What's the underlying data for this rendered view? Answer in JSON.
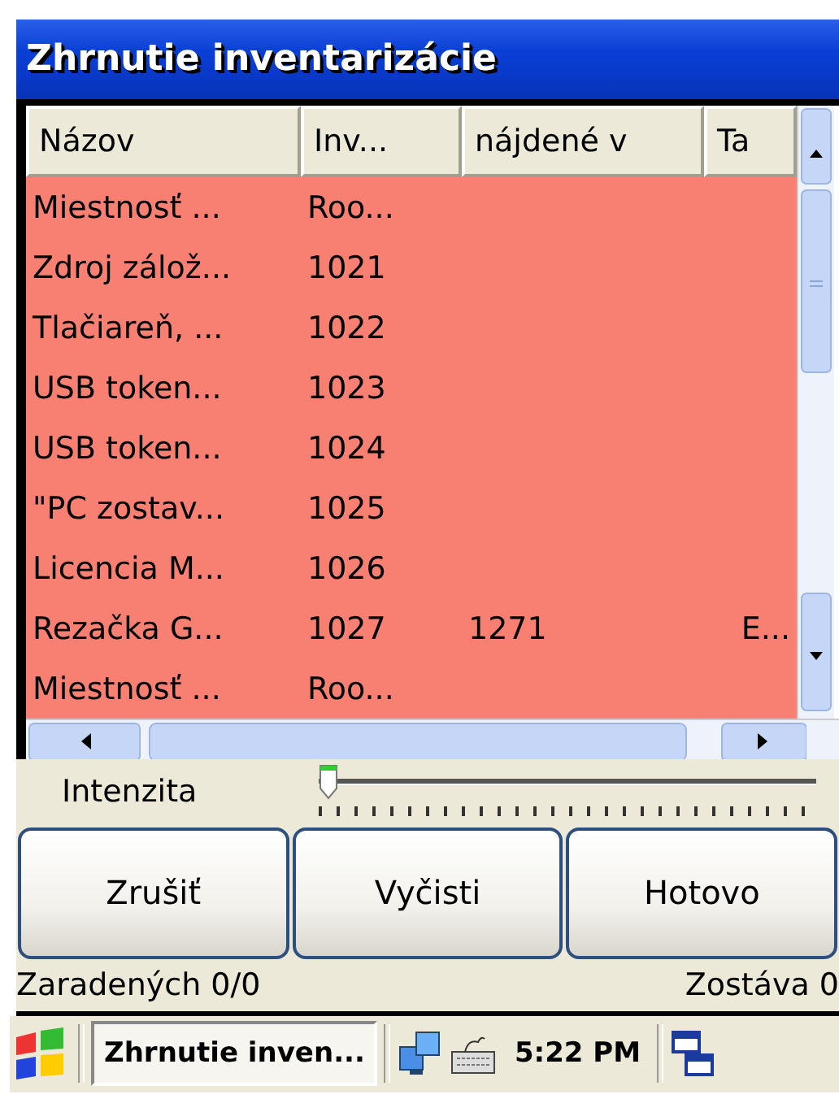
{
  "window": {
    "title": "Zhrnutie inventarizácie"
  },
  "table": {
    "columns": [
      "Názov",
      "Inv...",
      "nájdené v",
      "Ta"
    ],
    "rows": [
      {
        "name": "Miestnosť ...",
        "inventory_no": "Roo..."
      },
      {
        "name": "Zdroj zálož...",
        "inventory_no": "1021"
      },
      {
        "name": "Tlačiareň, ...",
        "inventory_no": "1022"
      },
      {
        "name": "USB token...",
        "inventory_no": "1023"
      },
      {
        "name": "USB token...",
        "inventory_no": "1024"
      },
      {
        "name": "\"PC zostav...",
        "inventory_no": "1025"
      },
      {
        "name": "Licencia M...",
        "inventory_no": "1026"
      },
      {
        "name": "Rezačka G...",
        "inventory_no": "1027",
        "found_in": "1271",
        "column_4": "E..."
      },
      {
        "name": "Miestnosť ...",
        "inventory_no": "Roo..."
      }
    ]
  },
  "slider": {
    "label": "Intenzita",
    "level": 0
  },
  "buttons": [
    "Zrušiť",
    "Vyčisti",
    "Hotovo"
  ],
  "status_bar": {
    "assigned": "Zaradených 0/0",
    "remaining": "Zostáva 0"
  },
  "taskbar": {
    "task": "Zhrnutie inven...",
    "time": "5:22 PM"
  }
}
